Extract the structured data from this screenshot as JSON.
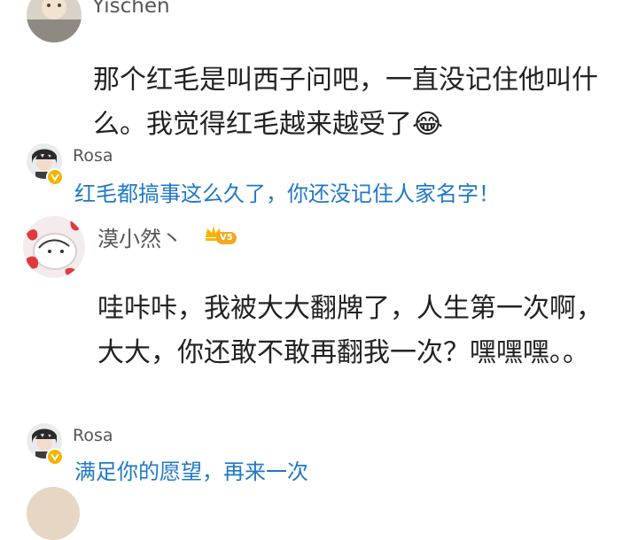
{
  "comments": [
    {
      "author": "Yischen",
      "text": "那个红毛是叫西子问吧，一直没记住他叫什么。我觉得红毛越来越受了😂",
      "reply": {
        "author": "Rosa",
        "text": "红毛都搞事这么久了，你还没记住人家名字！"
      }
    },
    {
      "author": "漠小然丶",
      "level_badge": "V5",
      "text": "哇咔咔，我被大大翻牌了，人生第一次啊，大大，你还敢不敢再翻我一次？嘿嘿嘿。。",
      "reply": {
        "author": "Rosa",
        "text": "满足你的愿望，再来一次"
      }
    }
  ],
  "icons": {
    "verified": "verified-v-icon",
    "crown": "crown-icon",
    "laugh": "laughing-tears-emoji-icon"
  },
  "colors": {
    "reply_text": "#1f78c8",
    "name_text": "#555555",
    "body_text": "#222222",
    "verified_badge": "#f5b400",
    "level_badge": "#f7a81b"
  }
}
